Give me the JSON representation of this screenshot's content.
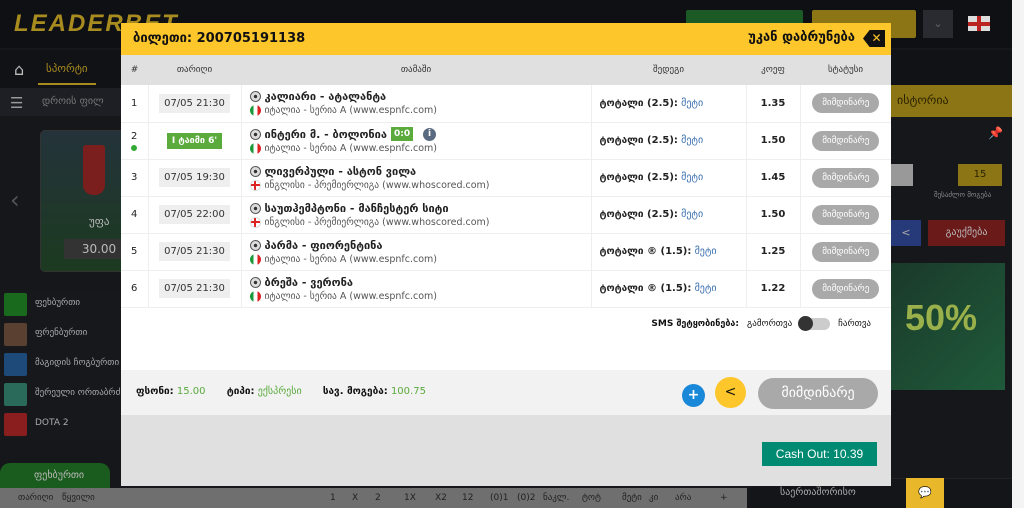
{
  "background": {
    "logo": "LEADERBET",
    "nav_sport": "სპორტი",
    "filter_text": "დროის ფილ",
    "banner_team": "უფა",
    "banner_odd": "30.00",
    "sports": [
      {
        "label": "ფეხბურთი",
        "color": "#1a6a1e"
      },
      {
        "label": "ფრენბურთი",
        "color": "#5a4030"
      },
      {
        "label": "მაგიდის ჩოგბურთი",
        "color": "#1e4a7a"
      },
      {
        "label": "შერეული ორთაბრძ...",
        "color": "#2a6a5a"
      },
      {
        "label": "DOTA 2",
        "color": "#8a1e1e"
      }
    ],
    "bottom_tab": "ფეხბურთი",
    "bottom_bar": {
      "left": [
        "თარიღი",
        "წყვილი"
      ],
      "cols": [
        "1",
        "X",
        "2",
        "1X",
        "X2",
        "12",
        "(0)1",
        "(0)2",
        "ნაკლ.",
        "ტოტ",
        "მეტი",
        "კი",
        "არა",
        "+"
      ]
    },
    "right_panel": {
      "history": "ისტორია",
      "possible_win_value": "15",
      "possible_win_label": "შესაძლო მოგება",
      "cancel": "გაუქმება",
      "promo": "50%",
      "sub": "საერთაშორისო"
    }
  },
  "modal": {
    "title": "ბილეთი: 200705191138",
    "back_label": "უკან დაბრუნება",
    "columns": [
      "#",
      "თარიღი",
      "თამაში",
      "შედეგი",
      "კოეფ",
      "სტატუსი"
    ],
    "rows": [
      {
        "n": "1",
        "date": "07/05 21:30",
        "game": "კალიარი - ატალანტა",
        "league": "იტალია - სერია A (www.espnfc.com)",
        "flag": "it",
        "result": "ტოტალი (2.5):",
        "pick": "მეტი",
        "coef": "1.35",
        "status": "მიმდინარე"
      },
      {
        "n": "2",
        "date": "I ტაიმი 6'",
        "live": true,
        "score": "0:0",
        "game": "ინტერი მ. - ბოლონია",
        "league": "იტალია - სერია A (www.espnfc.com)",
        "flag": "it",
        "result": "ტოტალი (2.5):",
        "pick": "მეტი",
        "coef": "1.50",
        "status": "მიმდინარე"
      },
      {
        "n": "3",
        "date": "07/05 19:30",
        "game": "ლივერპული - ასტონ ვილა",
        "league": "ინგლისი - პრემიერლიგა (www.whoscored.com)",
        "flag": "en",
        "result": "ტოტალი (2.5):",
        "pick": "მეტი",
        "coef": "1.45",
        "status": "მიმდინარე"
      },
      {
        "n": "4",
        "date": "07/05 22:00",
        "game": "საუთჰემპტონი - მანჩესტერ სიტი",
        "league": "ინგლისი - პრემიერლიგა (www.whoscored.com)",
        "flag": "en",
        "result": "ტოტალი (2.5):",
        "pick": "მეტი",
        "coef": "1.50",
        "status": "მიმდინარე"
      },
      {
        "n": "5",
        "date": "07/05 21:30",
        "game": "პარმა - ფიორენტინა",
        "league": "იტალია - სერია A (www.espnfc.com)",
        "flag": "it",
        "result": "ტოტალი ® (1.5):",
        "pick": "მეტი",
        "coef": "1.25",
        "status": "მიმდინარე"
      },
      {
        "n": "6",
        "date": "07/05 21:30",
        "game": "ბრეშა - ვერონა",
        "league": "იტალია - სერია A (www.espnfc.com)",
        "flag": "it",
        "result": "ტოტალი ® (1.5):",
        "pick": "მეტი",
        "coef": "1.22",
        "status": "მიმდინარე"
      }
    ],
    "sms_label": "SMS შეტყობინება:",
    "sms_off": "გამორთვა",
    "sms_on": "ჩართვა",
    "sms_enabled": false,
    "stake_label": "ფსონი:",
    "stake": "15.00",
    "type_label": "ტიპი:",
    "type": "ექსპრესი",
    "win_label": "სავ. მოგება:",
    "win": "100.75",
    "status_button": "მიმდინარე",
    "cashout": "Cash Out: 10.39"
  },
  "colors": {
    "accent": "#fdc62b",
    "live": "#5aaa3c",
    "cashout": "#008a72",
    "plus": "#1a88d8"
  }
}
